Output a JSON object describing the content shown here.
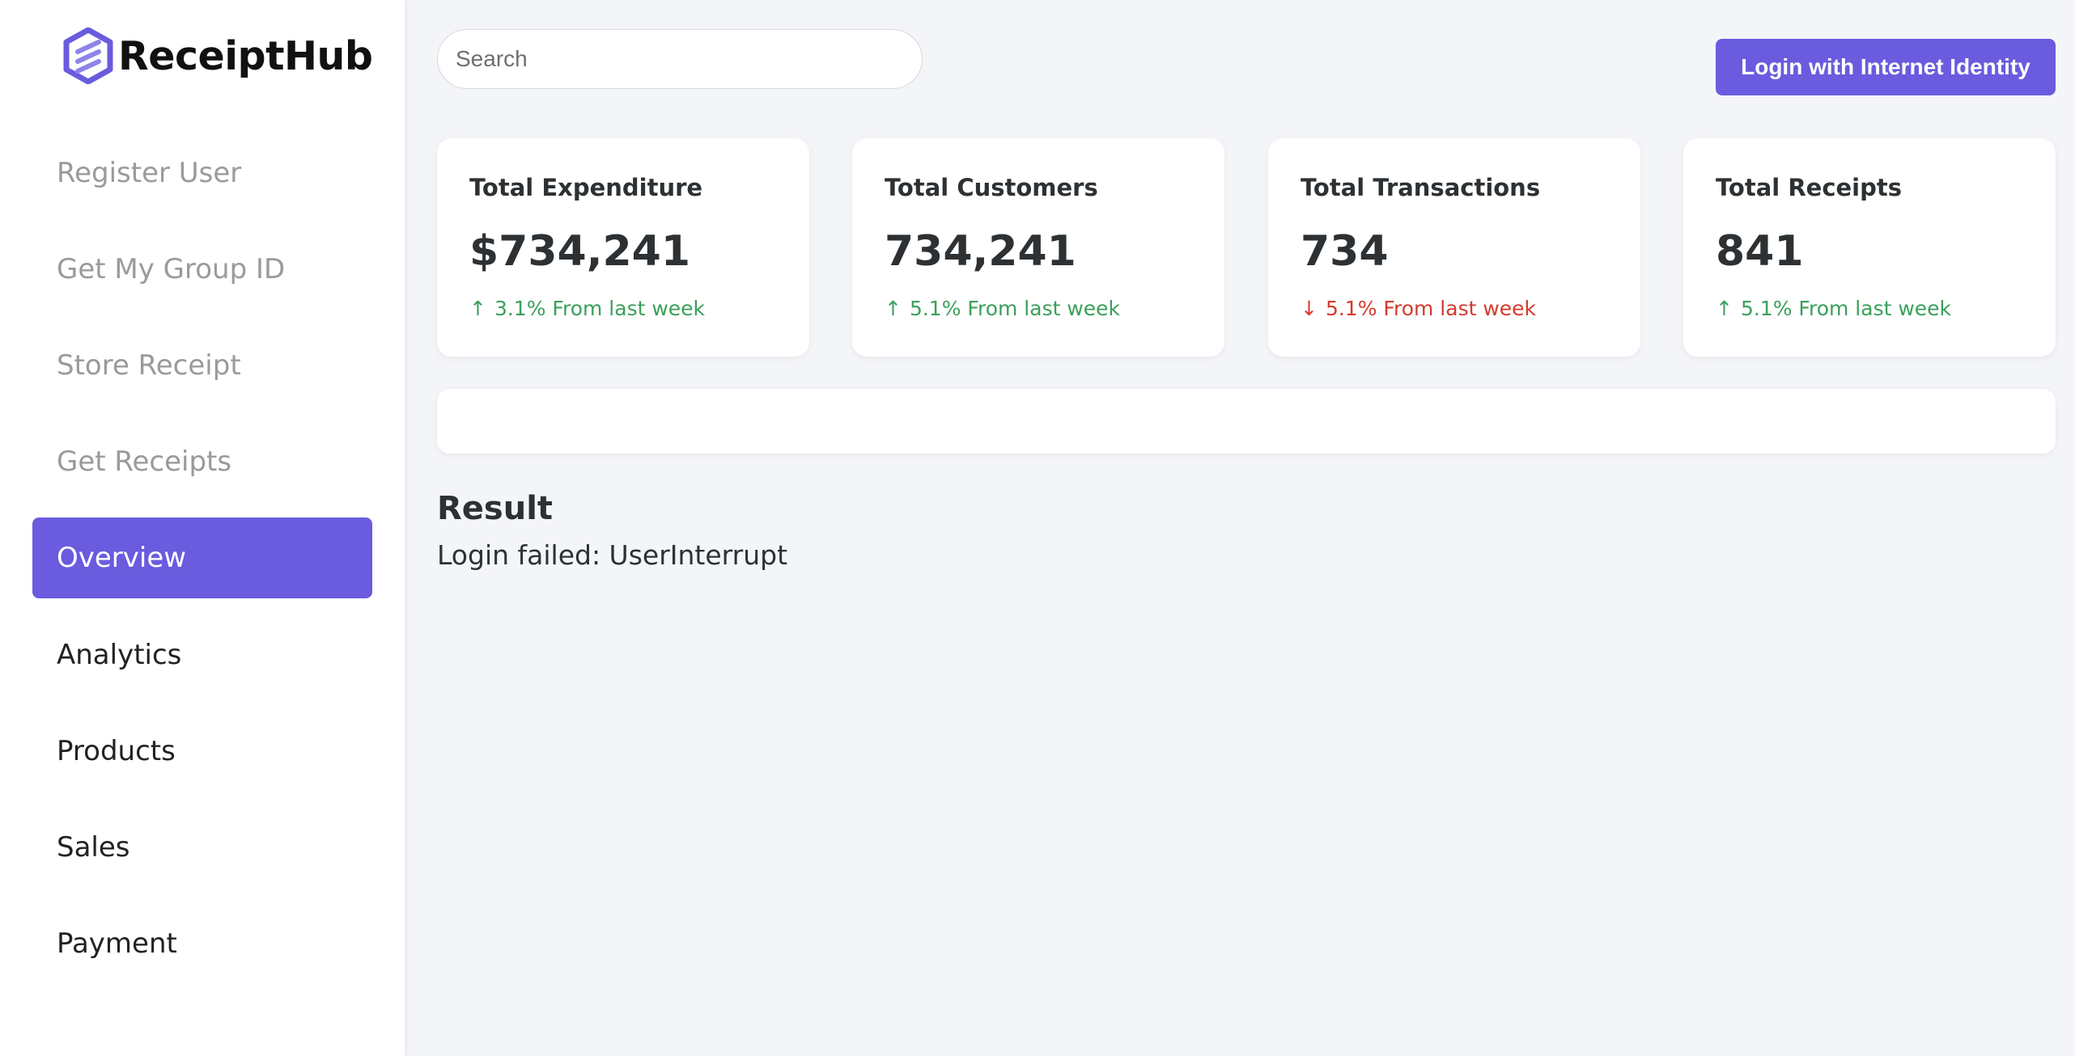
{
  "brand": {
    "name": "ReceiptHub",
    "logo_icon": "hexagon-logo-icon",
    "accent": "#6a5bdf"
  },
  "sidebar": {
    "items": [
      {
        "label": "Register User",
        "state": "muted"
      },
      {
        "label": "Get My Group ID",
        "state": "muted"
      },
      {
        "label": "Store Receipt",
        "state": "muted"
      },
      {
        "label": "Get Receipts",
        "state": "muted"
      },
      {
        "label": "Overview",
        "state": "active"
      },
      {
        "label": "Analytics",
        "state": "normal"
      },
      {
        "label": "Products",
        "state": "normal"
      },
      {
        "label": "Sales",
        "state": "normal"
      },
      {
        "label": "Payment",
        "state": "normal"
      }
    ]
  },
  "header": {
    "search_placeholder": "Search",
    "login_label": "Login with Internet Identity"
  },
  "stats": [
    {
      "title": "Total Expenditure",
      "value": "$734,241",
      "trend": "3.1% From last week",
      "direction": "up"
    },
    {
      "title": "Total Customers",
      "value": "734,241",
      "trend": "5.1% From last week",
      "direction": "up"
    },
    {
      "title": "Total Transactions",
      "value": "734",
      "trend": "5.1% From last week",
      "direction": "down"
    },
    {
      "title": "Total Receipts",
      "value": "841",
      "trend": "5.1% From last week",
      "direction": "up"
    }
  ],
  "colors": {
    "up": "#3aa05a",
    "down": "#d53b2d"
  },
  "result": {
    "title": "Result",
    "message": "Login failed: UserInterrupt"
  }
}
